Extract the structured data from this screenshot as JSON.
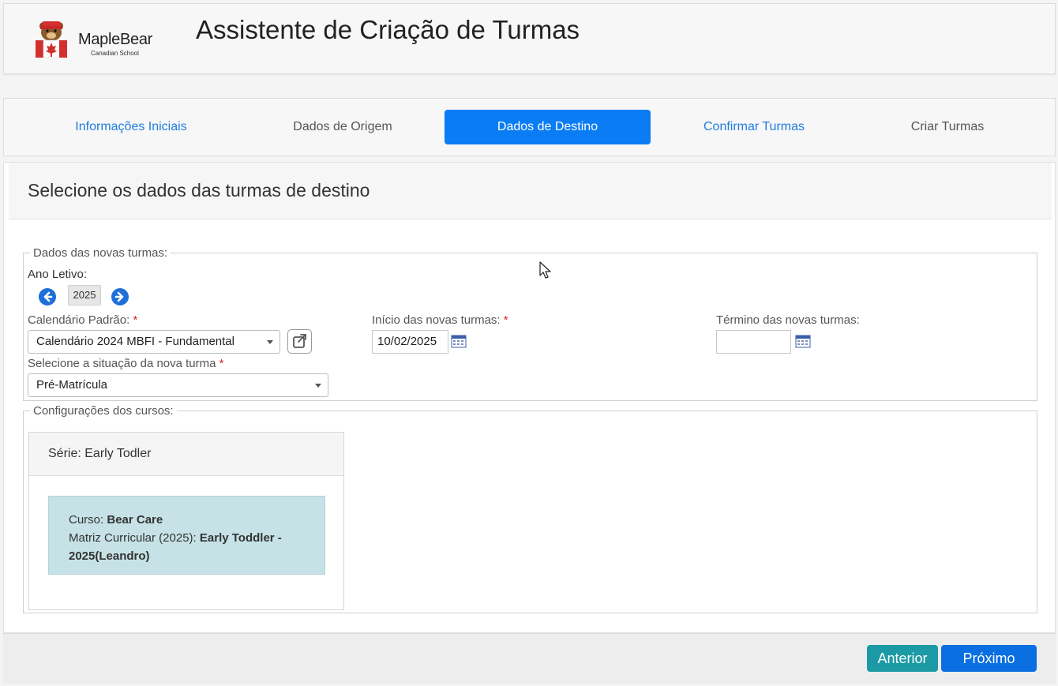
{
  "header": {
    "logo_text": "MapleBear",
    "logo_sub": "Canadian School",
    "title": "Assistente de Criação de Turmas"
  },
  "steps": [
    {
      "label": "Informações Iniciais",
      "state": "done"
    },
    {
      "label": "Dados de Origem",
      "state": "inactive"
    },
    {
      "label": "Dados de Destino",
      "state": "active"
    },
    {
      "label": "Confirmar Turmas",
      "state": "done"
    },
    {
      "label": "Criar Turmas",
      "state": "inactive"
    }
  ],
  "section": {
    "title": "Selecione os dados das turmas de destino"
  },
  "novas_turmas": {
    "legend": "Dados das novas turmas:",
    "ano_letivo_label": "Ano Letivo:",
    "ano_letivo_value": "2025",
    "calendario_label": "Calendário Padrão:",
    "calendario_value": "Calendário 2024 MBFI - Fundamental",
    "inicio_label": "Início das novas turmas:",
    "inicio_value": "10/02/2025",
    "termino_label": "Término das novas turmas:",
    "termino_value": "",
    "situacao_label": "Selecione a situação da nova turma",
    "situacao_value": "Pré-Matrícula",
    "required_mark": "*"
  },
  "cursos": {
    "legend": "Configurações dos cursos:",
    "serie_label": "Série:",
    "serie_value": "Early Todler",
    "curso_label": "Curso:",
    "curso_value": "Bear Care",
    "matriz_label": "Matriz Curricular (2025):",
    "matriz_value_1": "Early Toddler -",
    "matriz_value_2": "2025(Leandro)"
  },
  "footer": {
    "prev_label": "Anterior",
    "next_label": "Próximo"
  },
  "colors": {
    "active_step": "#0a7df5",
    "done_step_text": "#1f7de0",
    "prev_button": "#1b9aa5",
    "next_button": "#0a6fe0",
    "course_box": "#c6e2e6",
    "required": "#d9232d"
  },
  "icons": {
    "prev_year": "arrow-left-circle-icon",
    "next_year": "arrow-right-circle-icon",
    "open_calendar_link": "external-link-icon",
    "date_picker": "calendar-icon"
  }
}
